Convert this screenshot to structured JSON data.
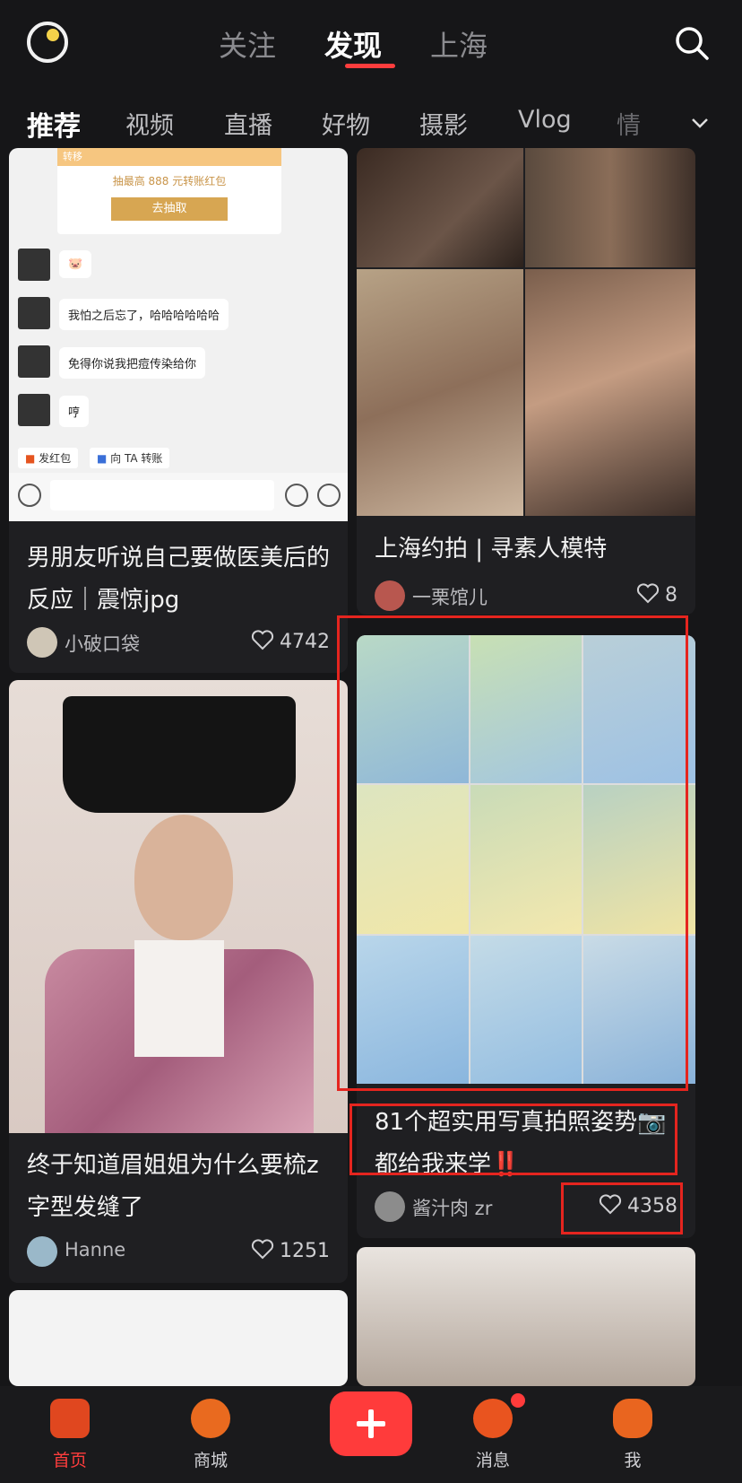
{
  "top_nav": {
    "tabs": [
      "关注",
      "发现",
      "上海"
    ],
    "active": "发现"
  },
  "sub_nav": {
    "tabs": [
      "推荐",
      "视频",
      "直播",
      "好物",
      "摄影",
      "Vlog",
      "情"
    ]
  },
  "chat": {
    "banner_label": "转移",
    "banner_text": "抽最高 888 元转账红包",
    "banner_button": "去抽取",
    "messages": [
      "🐷",
      "我怕之后忘了，哈哈哈哈哈哈",
      "免得你说我把痘传染给你",
      "哼"
    ],
    "actions": [
      "发红包",
      "向 TA 转账"
    ]
  },
  "cards": [
    {
      "title": "男朋友听说自己要做医美后的反应｜震惊jpg",
      "author": "小破口袋",
      "likes": "4742"
    },
    {
      "title": "上海约拍 | 寻素人模特",
      "author": "一栗馆儿",
      "likes": "8"
    },
    {
      "title": "终于知道眉姐姐为什么要梳z字型发缝了",
      "author": "Hanne",
      "likes": "1251"
    },
    {
      "title": "81个超实用写真拍照姿势📷都给我来学‼️",
      "author": "酱汁肉 zr",
      "likes": "4358"
    }
  ],
  "bottom_nav": [
    {
      "label": "首页",
      "active": true
    },
    {
      "label": "商城"
    },
    {
      "label": "消息"
    },
    {
      "label": "我"
    }
  ],
  "colors": {
    "accent": "#ff3d3d",
    "bg": "#161618",
    "card": "#1f1f22",
    "highlight": "#e5251f"
  }
}
